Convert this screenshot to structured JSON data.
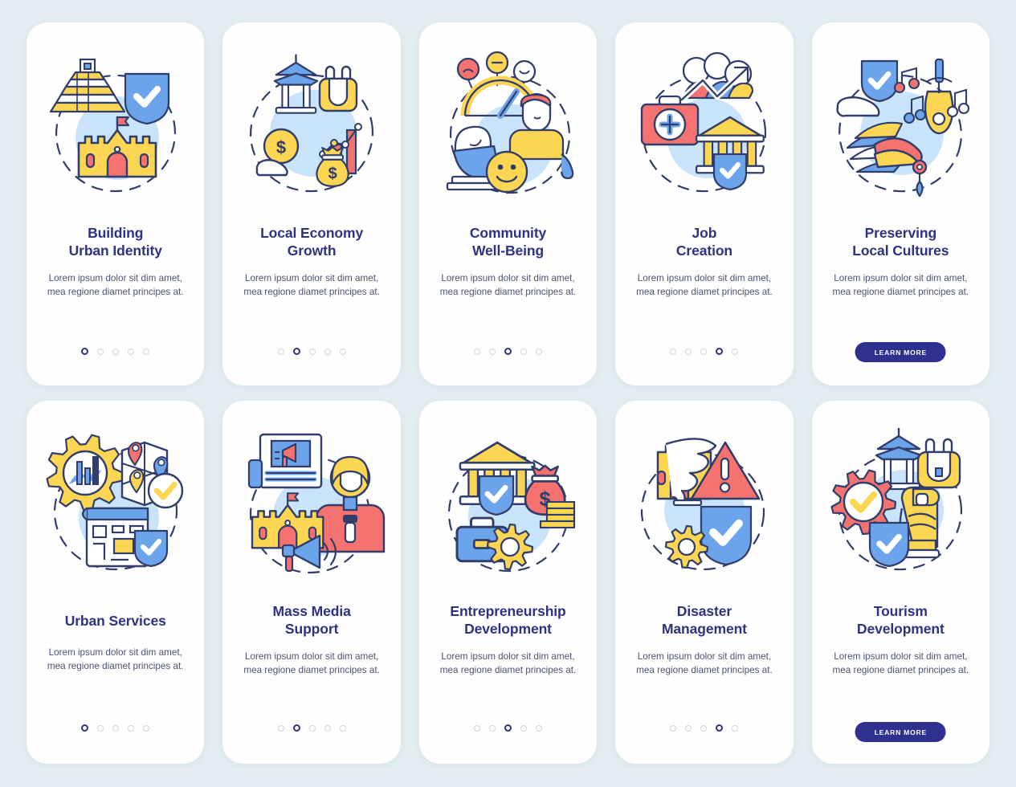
{
  "page": {
    "background_color": "#e2eef1",
    "title_color": "#2f3183",
    "body_color": "#4d5270",
    "button_color": "#2e3190",
    "palette": {
      "yellow": "#fcd552",
      "blue": "#6ba4ea",
      "light_blue": "#c9e3fa",
      "coral": "#f4726f",
      "navy_outline": "#313d6a",
      "white": "#ffffff"
    }
  },
  "screens": [
    {
      "id": "building-urban-identity",
      "title": "Building\nUrban Identity",
      "title_lines": [
        "Building",
        "Urban Identity"
      ],
      "description": "Lorem ipsum dolor sit dim amet, mea regione diamet principes at.",
      "icon_name": "pyramid-castle-shield-illustration",
      "dots_total": 5,
      "dot_active_index": 0,
      "has_button": false,
      "button_label": ""
    },
    {
      "id": "local-economy-growth",
      "title": "Local Economy\nGrowth",
      "title_lines": [
        "Local Economy",
        "Growth"
      ],
      "description": "Lorem ipsum dolor sit dim amet, mea regione diamet principes at.",
      "icon_name": "pagoda-coin-moneybag-chart-illustration",
      "dots_total": 5,
      "dot_active_index": 1,
      "has_button": false,
      "button_label": ""
    },
    {
      "id": "community-well-being",
      "title": "Community\nWell-Being",
      "title_lines": [
        "Community",
        "Well-Being"
      ],
      "description": "Lorem ipsum dolor sit dim amet, mea regione diamet principes at.",
      "icon_name": "people-gauge-smiley-statue-illustration",
      "dots_total": 5,
      "dot_active_index": 2,
      "has_button": false,
      "button_label": ""
    },
    {
      "id": "job-creation",
      "title": "Job\nCreation",
      "title_lines": [
        "Job",
        "Creation"
      ],
      "description": "Lorem ipsum dolor sit dim amet, mea regione diamet principes at.",
      "icon_name": "briefcase-bank-growth-shield-illustration",
      "dots_total": 5,
      "dot_active_index": 3,
      "has_button": false,
      "button_label": ""
    },
    {
      "id": "preserving-local-cultures",
      "title": "Preserving\nLocal Cultures",
      "title_lines": [
        "Preserving",
        "Local Cultures"
      ],
      "description": "Lorem ipsum dolor sit dim amet, mea regione diamet principes at.",
      "icon_name": "headdress-lute-music-shield-illustration",
      "dots_total": 0,
      "dot_active_index": -1,
      "has_button": true,
      "button_label": "LEARN MORE"
    },
    {
      "id": "urban-services",
      "title": "Urban Services",
      "title_lines": [
        "Urban Services"
      ],
      "description": "Lorem ipsum dolor sit dim amet, mea regione diamet principes at.",
      "icon_name": "gear-map-blueprint-shield-illustration",
      "dots_total": 5,
      "dot_active_index": 0,
      "has_button": false,
      "button_label": ""
    },
    {
      "id": "mass-media-support",
      "title": "Mass Media\nSupport",
      "title_lines": [
        "Mass Media",
        "Support"
      ],
      "description": "Lorem ipsum dolor sit dim amet, mea regione diamet principes at.",
      "icon_name": "newspaper-megaphone-reporter-castle-illustration",
      "dots_total": 5,
      "dot_active_index": 1,
      "has_button": false,
      "button_label": ""
    },
    {
      "id": "entrepreneurship-development",
      "title": "Entrepreneurship\nDevelopment",
      "title_lines": [
        "Entrepreneurship",
        "Development"
      ],
      "description": "Lorem ipsum dolor sit dim amet, mea regione diamet principes at.",
      "icon_name": "bank-briefcase-moneybag-gear-illustration",
      "dots_total": 5,
      "dot_active_index": 2,
      "has_button": false,
      "button_label": ""
    },
    {
      "id": "disaster-management",
      "title": "Disaster\nManagement",
      "title_lines": [
        "Disaster",
        "Management"
      ],
      "description": "Lorem ipsum dolor sit dim amet, mea regione diamet principes at.",
      "icon_name": "tornado-castle-warning-shield-illustration",
      "dots_total": 5,
      "dot_active_index": 3,
      "has_button": false,
      "button_label": ""
    },
    {
      "id": "tourism-development",
      "title": "Tourism\nDevelopment",
      "title_lines": [
        "Tourism",
        "Development"
      ],
      "description": "Lorem ipsum dolor sit dim amet, mea regione diamet principes at.",
      "icon_name": "pagoda-backpack-gear-statue-shield-illustration",
      "dots_total": 0,
      "dot_active_index": -1,
      "has_button": true,
      "button_label": "LEARN MORE"
    }
  ]
}
